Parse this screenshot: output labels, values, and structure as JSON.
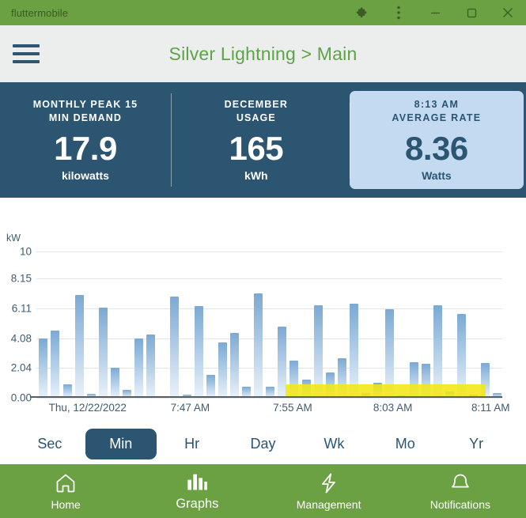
{
  "window": {
    "title": "fluttermobile",
    "controls": [
      {
        "name": "extensions-icon",
        "label": "Extensions"
      },
      {
        "name": "more-menu-icon",
        "label": "More"
      },
      {
        "name": "minimize-button",
        "label": "Minimize"
      },
      {
        "name": "maximize-button",
        "label": "Maximize"
      },
      {
        "name": "close-button",
        "label": "Close"
      }
    ]
  },
  "appbar": {
    "menu_label": "Menu",
    "title": "Silver Lightning > Main"
  },
  "stats": [
    {
      "label_line1": "MONTHLY PEAK 15",
      "label_line2": "MIN DEMAND",
      "value": "17.9",
      "unit": "kilowatts",
      "highlighted": false
    },
    {
      "label_line1": "DECEMBER",
      "label_line2": "USAGE",
      "value": "165",
      "unit": "kWh",
      "highlighted": false
    },
    {
      "label_line1": "8:13 AM",
      "label_line2": "AVERAGE RATE",
      "value": "8.36",
      "unit": "Watts",
      "highlighted": true
    }
  ],
  "chart_data": {
    "type": "bar",
    "title": "",
    "xlabel": "",
    "ylabel": "kW",
    "ylim": [
      0,
      10
    ],
    "grid": true,
    "legend": "none",
    "ytick_labels": [
      "10",
      "8.15",
      "6.11",
      "4.08",
      "2.04",
      "0.00"
    ],
    "ytick_values": [
      10,
      8.15,
      6.11,
      4.08,
      2.04,
      0.0
    ],
    "xtick_labels": [
      "Thu, 12/22/2022",
      "7:47 AM",
      "7:55 AM",
      "8:03 AM",
      "8:11 AM"
    ],
    "xtick_positions": [
      0.11,
      0.33,
      0.55,
      0.765,
      0.975
    ],
    "bar_color": "#7ba9d4",
    "values": [
      4.05,
      4.6,
      0.9,
      7.05,
      0.25,
      6.15,
      2.05,
      0.55,
      4.08,
      4.3,
      0.1,
      6.9,
      0.2,
      6.25,
      1.55,
      3.8,
      4.45,
      0.75,
      7.15,
      0.75,
      4.85,
      2.55,
      1.25,
      6.3,
      1.75,
      2.7,
      6.45,
      0.3,
      1.05,
      6.05,
      0.15,
      2.45,
      2.35,
      6.3,
      0.45,
      5.75,
      0.2,
      2.4,
      0.35
    ],
    "annotation": {
      "type": "highlighter",
      "color": "#f2e70d",
      "x_start_fraction": 0.535,
      "x_end_fraction": 0.965,
      "note": "yellow highlighter mark drawn over baseline of later bars"
    }
  },
  "ranges": {
    "options": [
      "Sec",
      "Min",
      "Hr",
      "Day",
      "Wk",
      "Mo",
      "Yr"
    ],
    "selected": "Min"
  },
  "bottomnav": {
    "items": [
      {
        "label": "Home",
        "icon": "home-icon",
        "active": false
      },
      {
        "label": "Graphs",
        "icon": "bar-chart-icon",
        "active": true
      },
      {
        "label": "Management",
        "icon": "lightning-bolt-icon",
        "active": false
      },
      {
        "label": "Notifications",
        "icon": "bell-icon",
        "active": false
      }
    ]
  },
  "colors": {
    "brand_green": "#6ba043",
    "dark_blue": "#2c5571",
    "light_blue_card": "#c3daf0",
    "highlighter_yellow": "#f2e70d"
  }
}
